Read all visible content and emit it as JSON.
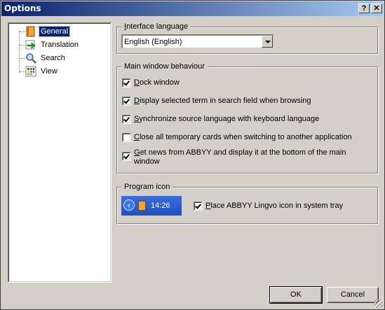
{
  "window": {
    "title": "Options",
    "help_glyph": "?",
    "close_glyph": "✕"
  },
  "tree": {
    "items": [
      {
        "label": "General",
        "icon": "general-book-icon",
        "selected": true
      },
      {
        "label": "Translation",
        "icon": "translation-arrow-icon",
        "selected": false
      },
      {
        "label": "Search",
        "icon": "search-magnifier-icon",
        "selected": false
      },
      {
        "label": "View",
        "icon": "view-grid-icon",
        "selected": false
      }
    ]
  },
  "interface_language": {
    "legend_prefix": "I",
    "legend_rest": "nterface language",
    "value": "English (English)"
  },
  "main_window": {
    "legend": "Main window behaviour",
    "options": [
      {
        "ul": "D",
        "rest": "ock window",
        "checked": true
      },
      {
        "ul": "D",
        "rest": "isplay selected term in search field when browsing",
        "checked": true
      },
      {
        "ul": "S",
        "rest": "ynchronize source language with keyboard language",
        "checked": true
      },
      {
        "ul": "C",
        "rest": "lose all temporary cards when switching to another application",
        "checked": false
      },
      {
        "ul": "G",
        "rest": "et news from ABBYY and display it at the bottom of the main",
        "line2": "window",
        "checked": true
      }
    ]
  },
  "program_icon": {
    "legend": "Program icon",
    "tray_time": "14:26",
    "tray_arrow": "‹",
    "option": {
      "ul": "P",
      "rest": "lace ABBYY Lingvo icon in system tray",
      "checked": true
    }
  },
  "buttons": {
    "ok": "OK",
    "cancel": "Cancel"
  },
  "colors": {
    "titlebar_start": "#0a246a",
    "titlebar_end": "#a6caf0",
    "face": "#d4d0c8",
    "selection": "#0a246a"
  }
}
